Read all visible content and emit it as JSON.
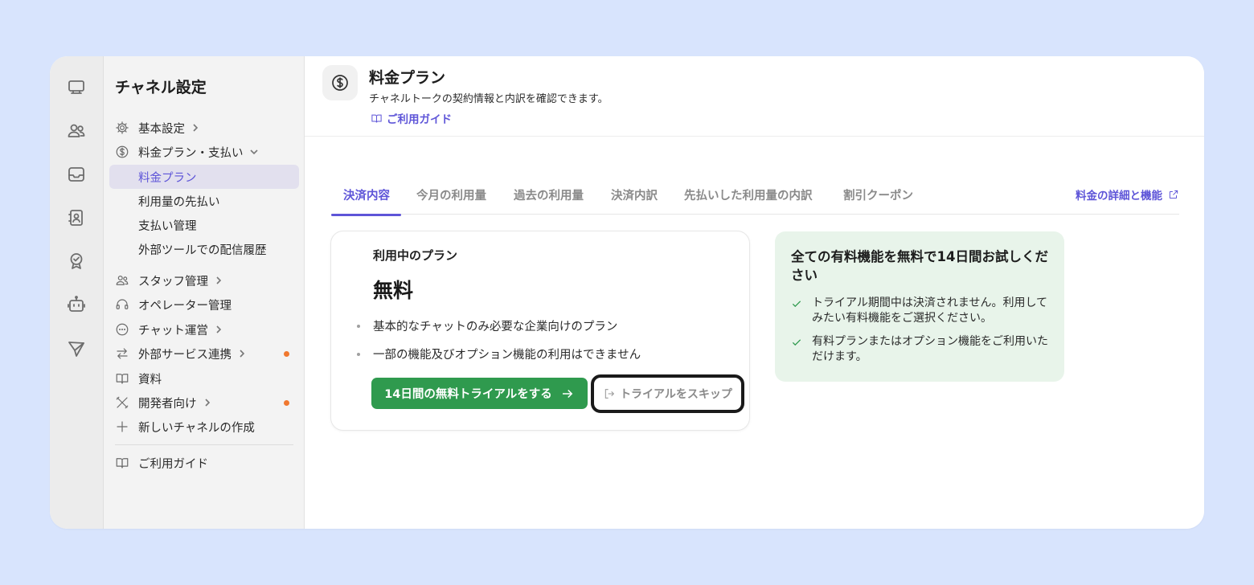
{
  "colors": {
    "accent": "#5e55d8",
    "primary_button": "#2f9a4e",
    "notification_dot": "#f0782f",
    "promo_background": "#e8f4ea",
    "page_background": "#d8e4fd"
  },
  "rail": {
    "icons": [
      "monitor-icon",
      "users-icon",
      "inbox-icon",
      "contacts-icon",
      "badge-icon",
      "bot-icon",
      "send-icon"
    ]
  },
  "sidebar": {
    "title": "チャネル設定",
    "items": [
      {
        "label": "基本設定",
        "icon": "gear-icon"
      },
      {
        "label": "料金プラン・支払い",
        "icon": "dollar-circle-icon"
      },
      {
        "label": "料金プラン"
      },
      {
        "label": "利用量の先払い"
      },
      {
        "label": "支払い管理"
      },
      {
        "label": "外部ツールでの配信履歴"
      },
      {
        "label": "スタッフ管理",
        "icon": "team-icon"
      },
      {
        "label": "オペレーター管理",
        "icon": "headset-icon"
      },
      {
        "label": "チャット運営",
        "icon": "chat-bubble-icon"
      },
      {
        "label": "外部サービス連携",
        "icon": "swap-arrows-icon"
      },
      {
        "label": "資料",
        "icon": "book-icon"
      },
      {
        "label": "開発者向け",
        "icon": "tools-icon"
      },
      {
        "label": "新しいチャネルの作成",
        "icon": "plus-icon"
      },
      {
        "label": "ご利用ガイド",
        "icon": "book-icon"
      }
    ]
  },
  "header": {
    "title": "料金プラン",
    "subtitle": "チャネルトークの契約情報と内訳を確認できます。",
    "guide_link": "ご利用ガイド"
  },
  "tabs": {
    "items": [
      "決済内容",
      "今月の利用量",
      "過去の利用量",
      "決済内訳",
      "先払いした利用量の内訳",
      "割引クーポン"
    ],
    "active_index": 0,
    "pricing_link": "料金の詳細と機能"
  },
  "plan_card": {
    "label": "利用中のプラン",
    "plan_name": "無料",
    "features": [
      "基本的なチャットのみ必要な企業向けのプラン",
      "一部の機能及びオプション機能の利用はできません"
    ],
    "trial_button": "14日間の無料トライアルをする",
    "skip_button": "トライアルをスキップ"
  },
  "trial_card": {
    "title": "全ての有料機能を無料で14日間お試しください",
    "points": [
      "トライアル期間中は決済されません。利用してみたい有料機能をご選択ください。",
      "有料プランまたはオプション機能をご利用いただけます。"
    ]
  }
}
